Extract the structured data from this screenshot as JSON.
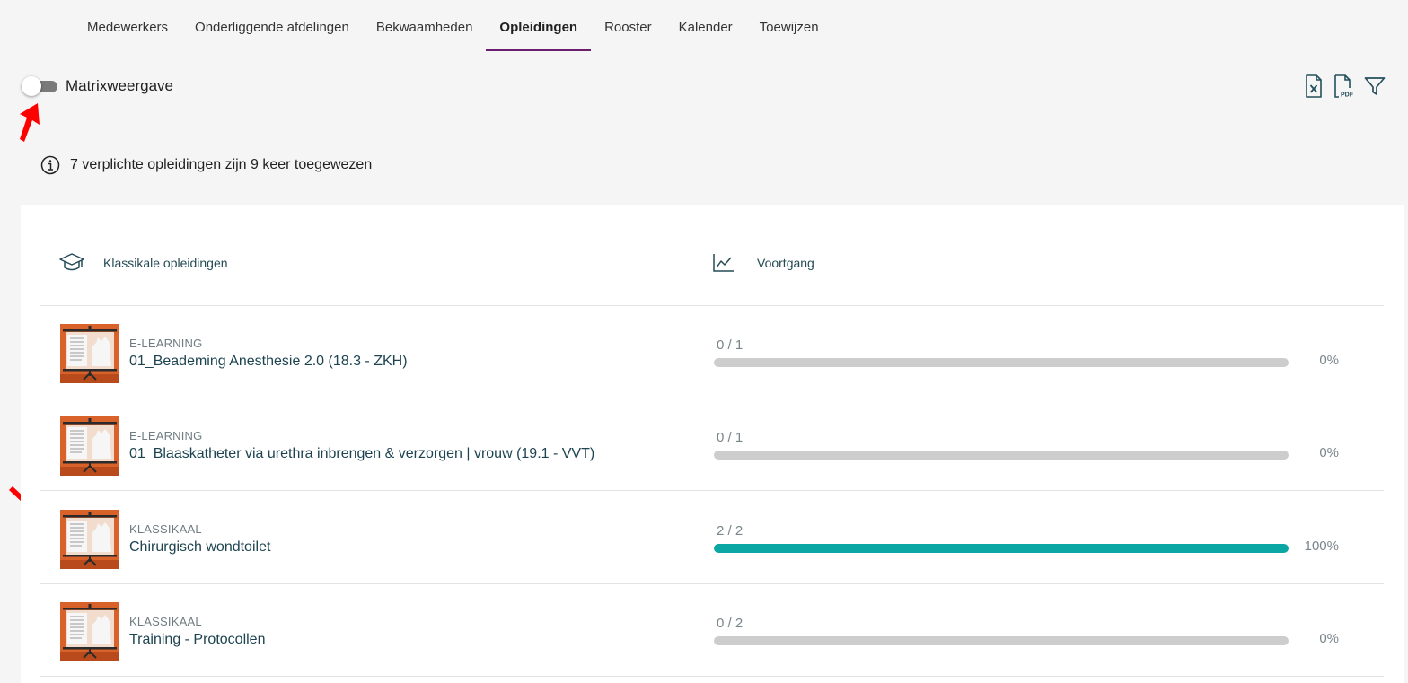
{
  "tabs": [
    {
      "label": "Medewerkers"
    },
    {
      "label": "Onderliggende afdelingen"
    },
    {
      "label": "Bekwaamheden"
    },
    {
      "label": "Opleidingen",
      "active": true
    },
    {
      "label": "Rooster"
    },
    {
      "label": "Kalender"
    },
    {
      "label": "Toewijzen"
    }
  ],
  "toggle": {
    "label": "Matrixweergave",
    "on": false
  },
  "tools": {
    "excel_icon": "excel-export-icon",
    "pdf_icon": "pdf-export-icon",
    "filter_icon": "filter-icon"
  },
  "info": {
    "text": "7 verplichte opleidingen zijn 9 keer toegewezen"
  },
  "table": {
    "col1": "Klassikale opleidingen",
    "col2": "Voortgang",
    "rows": [
      {
        "type": "E-LEARNING",
        "title": "01_Beademing Anesthesie 2.0 (18.3 - ZKH)",
        "count": "0 / 1",
        "pct": "0%",
        "progress": 0
      },
      {
        "type": "E-LEARNING",
        "title": "01_Blaaskatheter via urethra inbrengen & verzorgen | vrouw (19.1 - VVT)",
        "count": "0 / 1",
        "pct": "0%",
        "progress": 0
      },
      {
        "type": "KLASSIKAAL",
        "title": "Chirurgisch wondtoilet",
        "count": "2 / 2",
        "pct": "100%",
        "progress": 1
      },
      {
        "type": "KLASSIKAAL",
        "title": "Training - Protocollen",
        "count": "0 / 2",
        "pct": "0%",
        "progress": 0
      }
    ]
  },
  "colors": {
    "accent_tab": "#6b1d6e",
    "progress_fill": "#0aa7a4",
    "progress_track": "#cdcdcd",
    "thumb_orange": "#d9612a",
    "annotation_arrow": "#ff0000"
  }
}
